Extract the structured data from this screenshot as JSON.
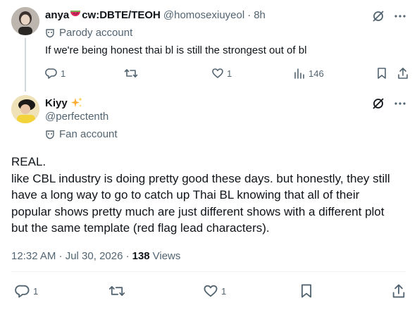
{
  "reply": {
    "display_name": "anya",
    "name_emoji": "🍉",
    "name_suffix": "cw:DBTE/TEOH",
    "handle": "@homosexiuyeol",
    "time": "8h",
    "label": "Parody account",
    "text": "If we're being honest thai bl is still the strongest out of bl",
    "replies": "1",
    "likes": "1",
    "views": "146"
  },
  "main": {
    "display_name": "Kiyy",
    "name_emoji": "✨",
    "handle": "@perfectenth",
    "label": "Fan account",
    "paragraphs": [
      "REAL.",
      "like CBL industry is doing pretty good these days. but honestly, they still",
      "have a long way to go to catch up Thai BL knowing that all of their",
      "popular shows pretty much are just different shows with a different plot",
      "but the same template (red flag lead characters)."
    ],
    "timestamp": "12:32 AM · Jul 30, 2026 ·",
    "views_count": "138",
    "views_label": "Views",
    "replies": "1",
    "likes": "1"
  },
  "icons": {
    "reply": "reply-icon",
    "repost": "repost-icon",
    "like": "like-icon",
    "views": "views-icon",
    "bookmark": "bookmark-icon",
    "share": "share-icon",
    "grok": "grok-icon",
    "more": "more-icon",
    "label": "mask-icon"
  },
  "colors": {
    "text": "#0f1419",
    "secondary": "#536471",
    "divider": "#eff3f4",
    "watermelon": "#e0245e",
    "sparkle": "#ffac33"
  }
}
